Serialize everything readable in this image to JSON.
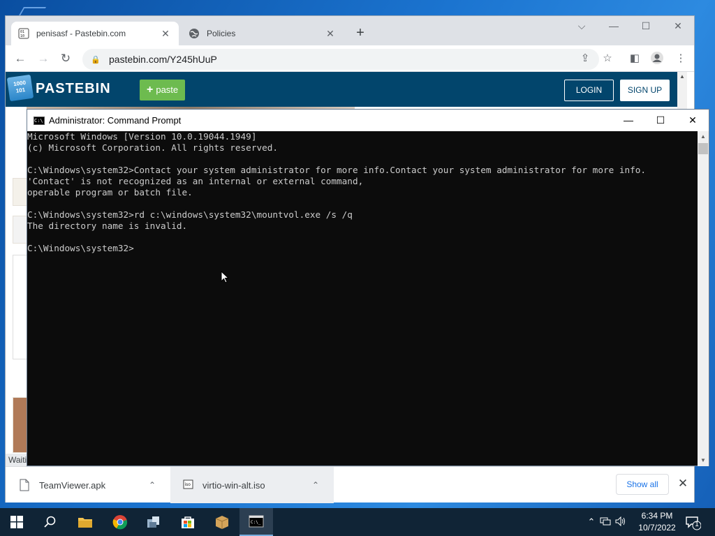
{
  "browser": {
    "tabs": [
      {
        "label": "penisasf - Pastebin.com",
        "icon": "pastebin-favicon",
        "active": true
      },
      {
        "label": "Policies",
        "icon": "globe-icon",
        "active": false
      }
    ],
    "new_tab": "+",
    "url": "pastebin.com/Y245hUuP"
  },
  "pastebin": {
    "logo_text": "1000\n101",
    "brand": "PASTEBIN",
    "paste_button": "paste",
    "login": "LOGIN",
    "signup": "SIGN UP",
    "status": "Waiti"
  },
  "downloads": {
    "items": [
      {
        "name": "TeamViewer.apk"
      },
      {
        "name": "virtio-win-alt.iso"
      }
    ],
    "show_all": "Show all"
  },
  "cmd": {
    "title": "Administrator: Command Prompt",
    "lines": [
      "Microsoft Windows [Version 10.0.19044.1949]",
      "(c) Microsoft Corporation. All rights reserved.",
      "",
      "C:\\Windows\\system32>Contact your system administrator for more info.Contact your system administrator for more info.",
      "'Contact' is not recognized as an internal or external command,",
      "operable program or batch file.",
      "",
      "C:\\Windows\\system32>rd c:\\windows\\system32\\mountvol.exe /s /q",
      "The directory name is invalid.",
      "",
      "C:\\Windows\\system32>"
    ]
  },
  "taskbar": {
    "time": "6:34 PM",
    "date": "10/7/2022",
    "notification_count": "1"
  }
}
